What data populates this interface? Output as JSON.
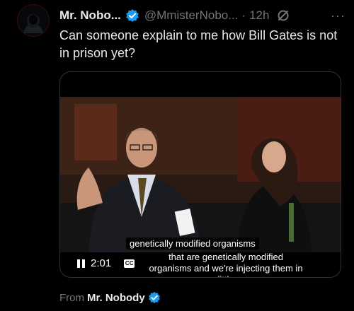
{
  "tweet": {
    "display_name": "Mr. Nobo...",
    "handle": "@MmisterNobo...",
    "separator": "·",
    "time": "12h",
    "more_label": "···",
    "text": "Can someone explain to me how Bill Gates is not in prison yet?"
  },
  "video": {
    "subtitle_top": "genetically modified organisms",
    "subtitle_bottom": "that are genetically modified organisms and we're injecting them in little",
    "elapsed": "2:01",
    "cc_label": "CC",
    "state": "playing"
  },
  "footer": {
    "from_label": "From",
    "source_name": "Mr. Nobody"
  },
  "colors": {
    "verified_blue": "#1d9bf0",
    "muted_text": "#71767b",
    "primary_text": "#e7e9ea",
    "background": "#000000"
  },
  "icons": {
    "verified": "verified-badge-icon",
    "grok": "grok-icon",
    "more": "more-icon",
    "pause": "pause-icon",
    "captions": "captions-icon"
  }
}
